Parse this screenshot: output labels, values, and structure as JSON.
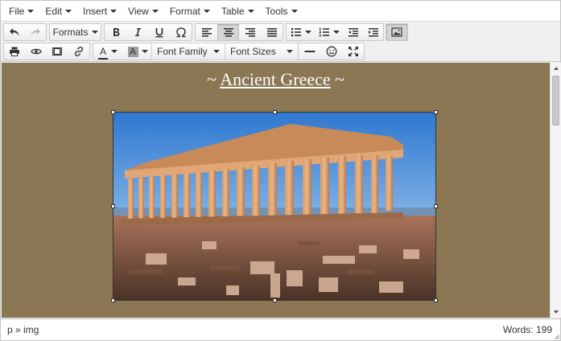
{
  "menubar": {
    "items": [
      {
        "label": "File"
      },
      {
        "label": "Edit"
      },
      {
        "label": "Insert"
      },
      {
        "label": "View"
      },
      {
        "label": "Format"
      },
      {
        "label": "Table"
      },
      {
        "label": "Tools"
      }
    ]
  },
  "toolbar": {
    "formats_label": "Formats",
    "font_family_label": "Font Family",
    "font_sizes_label": "Font Sizes",
    "text_color_letter": "A",
    "bg_color_letter": "A",
    "colors": {
      "text_color": "#333333",
      "bg_color": "#9e9e9e"
    }
  },
  "content": {
    "background": "#8b7753",
    "title_prefix": "~ ",
    "title_link": "Ancient Greece",
    "title_suffix": " ~"
  },
  "statusbar": {
    "path": "p » img",
    "word_count": "Words: 199"
  }
}
